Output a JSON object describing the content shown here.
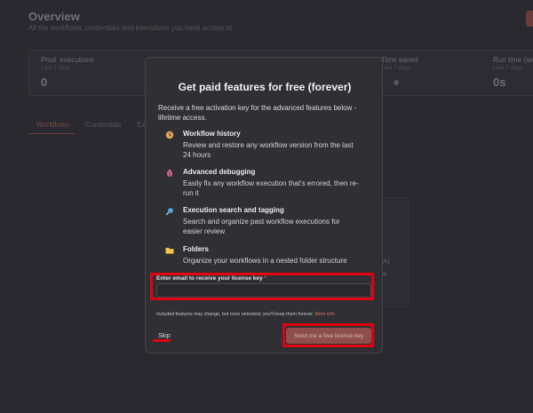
{
  "background": {
    "title": "Overview",
    "subtitle": "All the workflows, credentials and executions you have access to",
    "stats": [
      {
        "label": "Prod. executions",
        "sub": "Last 7 days",
        "value": "0",
        "info": false
      },
      {
        "label": "Time saved",
        "sub": "Last 7 days",
        "value": "",
        "info": true
      },
      {
        "label": "Run time (av",
        "sub": "Last 7 days",
        "value": "0s",
        "info": false
      }
    ],
    "tabs": [
      "Workflows",
      "Credentials",
      "Ex"
    ],
    "card_text": [
      "AI",
      "e"
    ]
  },
  "modal": {
    "title": "Get paid features for free (forever)",
    "intro": "Receive a free activation key for the advanced features below - lifetime access.",
    "features": [
      {
        "name": "Workflow history",
        "desc": "Review and restore any workflow version from the last 24 hours",
        "icon": "history-icon",
        "color": "#e8a45a"
      },
      {
        "name": "Advanced debugging",
        "desc": "Easily fix any workflow execution that's errored, then re-run it",
        "icon": "bug-icon",
        "color": "#d96a8a"
      },
      {
        "name": "Execution search and tagging",
        "desc": "Search and organize past workflow executions for easier review",
        "icon": "search-icon",
        "color": "#5aa9e6"
      },
      {
        "name": "Folders",
        "desc": "Organize your workflows in a nested folder structure",
        "icon": "folder-icon",
        "color": "#f0c54a"
      }
    ],
    "email": {
      "label": "Enter email to receive your license key",
      "required_marker": "*",
      "value": "",
      "placeholder": ""
    },
    "footnote": "Included features may change, but once unlocked, you'll keep them forever.",
    "more_info": "More info",
    "skip_label": "Skip",
    "send_label": "Send me a free license key"
  }
}
